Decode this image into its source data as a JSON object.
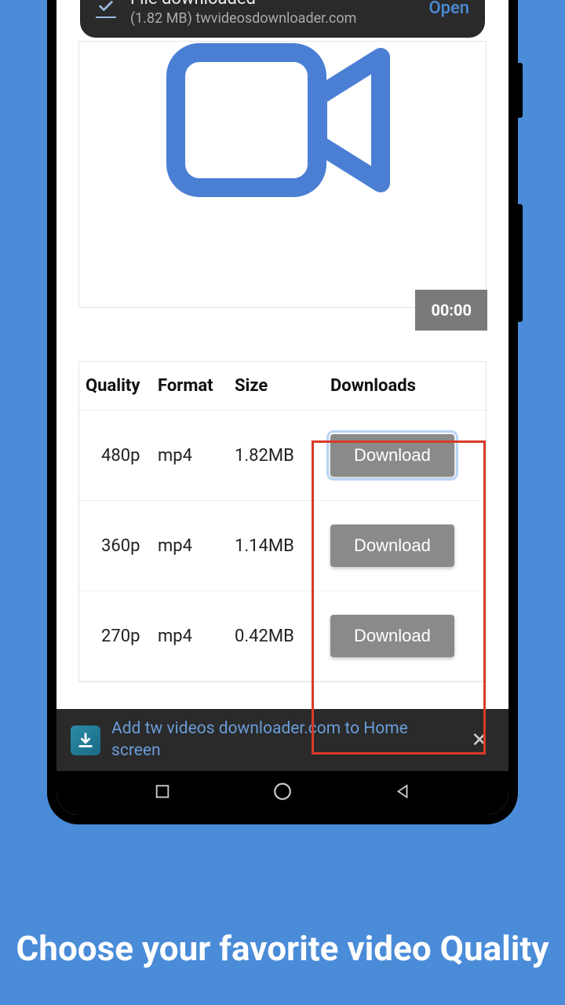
{
  "toast": {
    "title": "File downloaded",
    "subtitle": "(1.82 MB) twvideosdownloader.com",
    "action": "Open"
  },
  "video": {
    "duration": "00:00"
  },
  "table": {
    "headers": {
      "quality": "Quality",
      "format": "Format",
      "size": "Size",
      "downloads": "Downloads"
    },
    "rows": [
      {
        "quality": "480p",
        "format": "mp4",
        "size": "1.82MB",
        "button": "Download",
        "selected": true
      },
      {
        "quality": "360p",
        "format": "mp4",
        "size": "1.14MB",
        "button": "Download",
        "selected": false
      },
      {
        "quality": "270p",
        "format": "mp4",
        "size": "0.42MB",
        "button": "Download",
        "selected": false
      }
    ]
  },
  "banner": {
    "text": "Add tw videos downloader.com to Home screen"
  },
  "caption": "Choose your favorite video Quality"
}
